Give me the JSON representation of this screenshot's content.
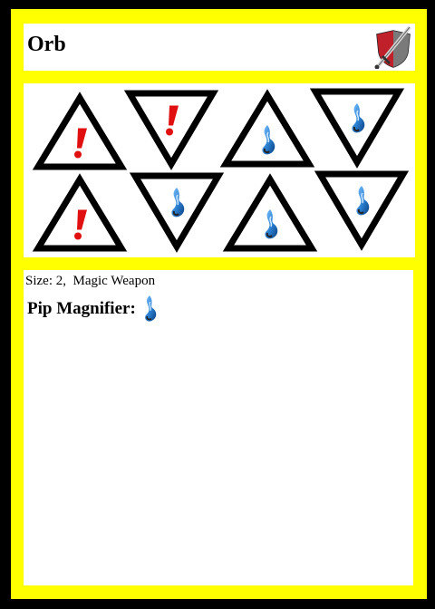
{
  "card": {
    "name": "Orb",
    "class_icon": "sword-shield-icon",
    "size_label": "Size: 2,",
    "type_label": "Magic Weapon",
    "ability_label": "Pip Magnifier:",
    "ability_icon": "blue-flame-icon"
  },
  "pips": [
    {
      "orientation": "up",
      "symbol": "red-exclamation"
    },
    {
      "orientation": "down",
      "symbol": "red-exclamation"
    },
    {
      "orientation": "up",
      "symbol": "blue-flame"
    },
    {
      "orientation": "down",
      "symbol": "blue-flame"
    },
    {
      "orientation": "up",
      "symbol": "red-exclamation"
    },
    {
      "orientation": "down",
      "symbol": "blue-flame"
    },
    {
      "orientation": "up",
      "symbol": "blue-flame"
    },
    {
      "orientation": "down",
      "symbol": "blue-flame"
    }
  ],
  "colors": {
    "border": "#ffff00",
    "background": "#000000",
    "panel": "#ffffff",
    "exclamation": "#e01010",
    "flame": "#2a7fd0"
  }
}
